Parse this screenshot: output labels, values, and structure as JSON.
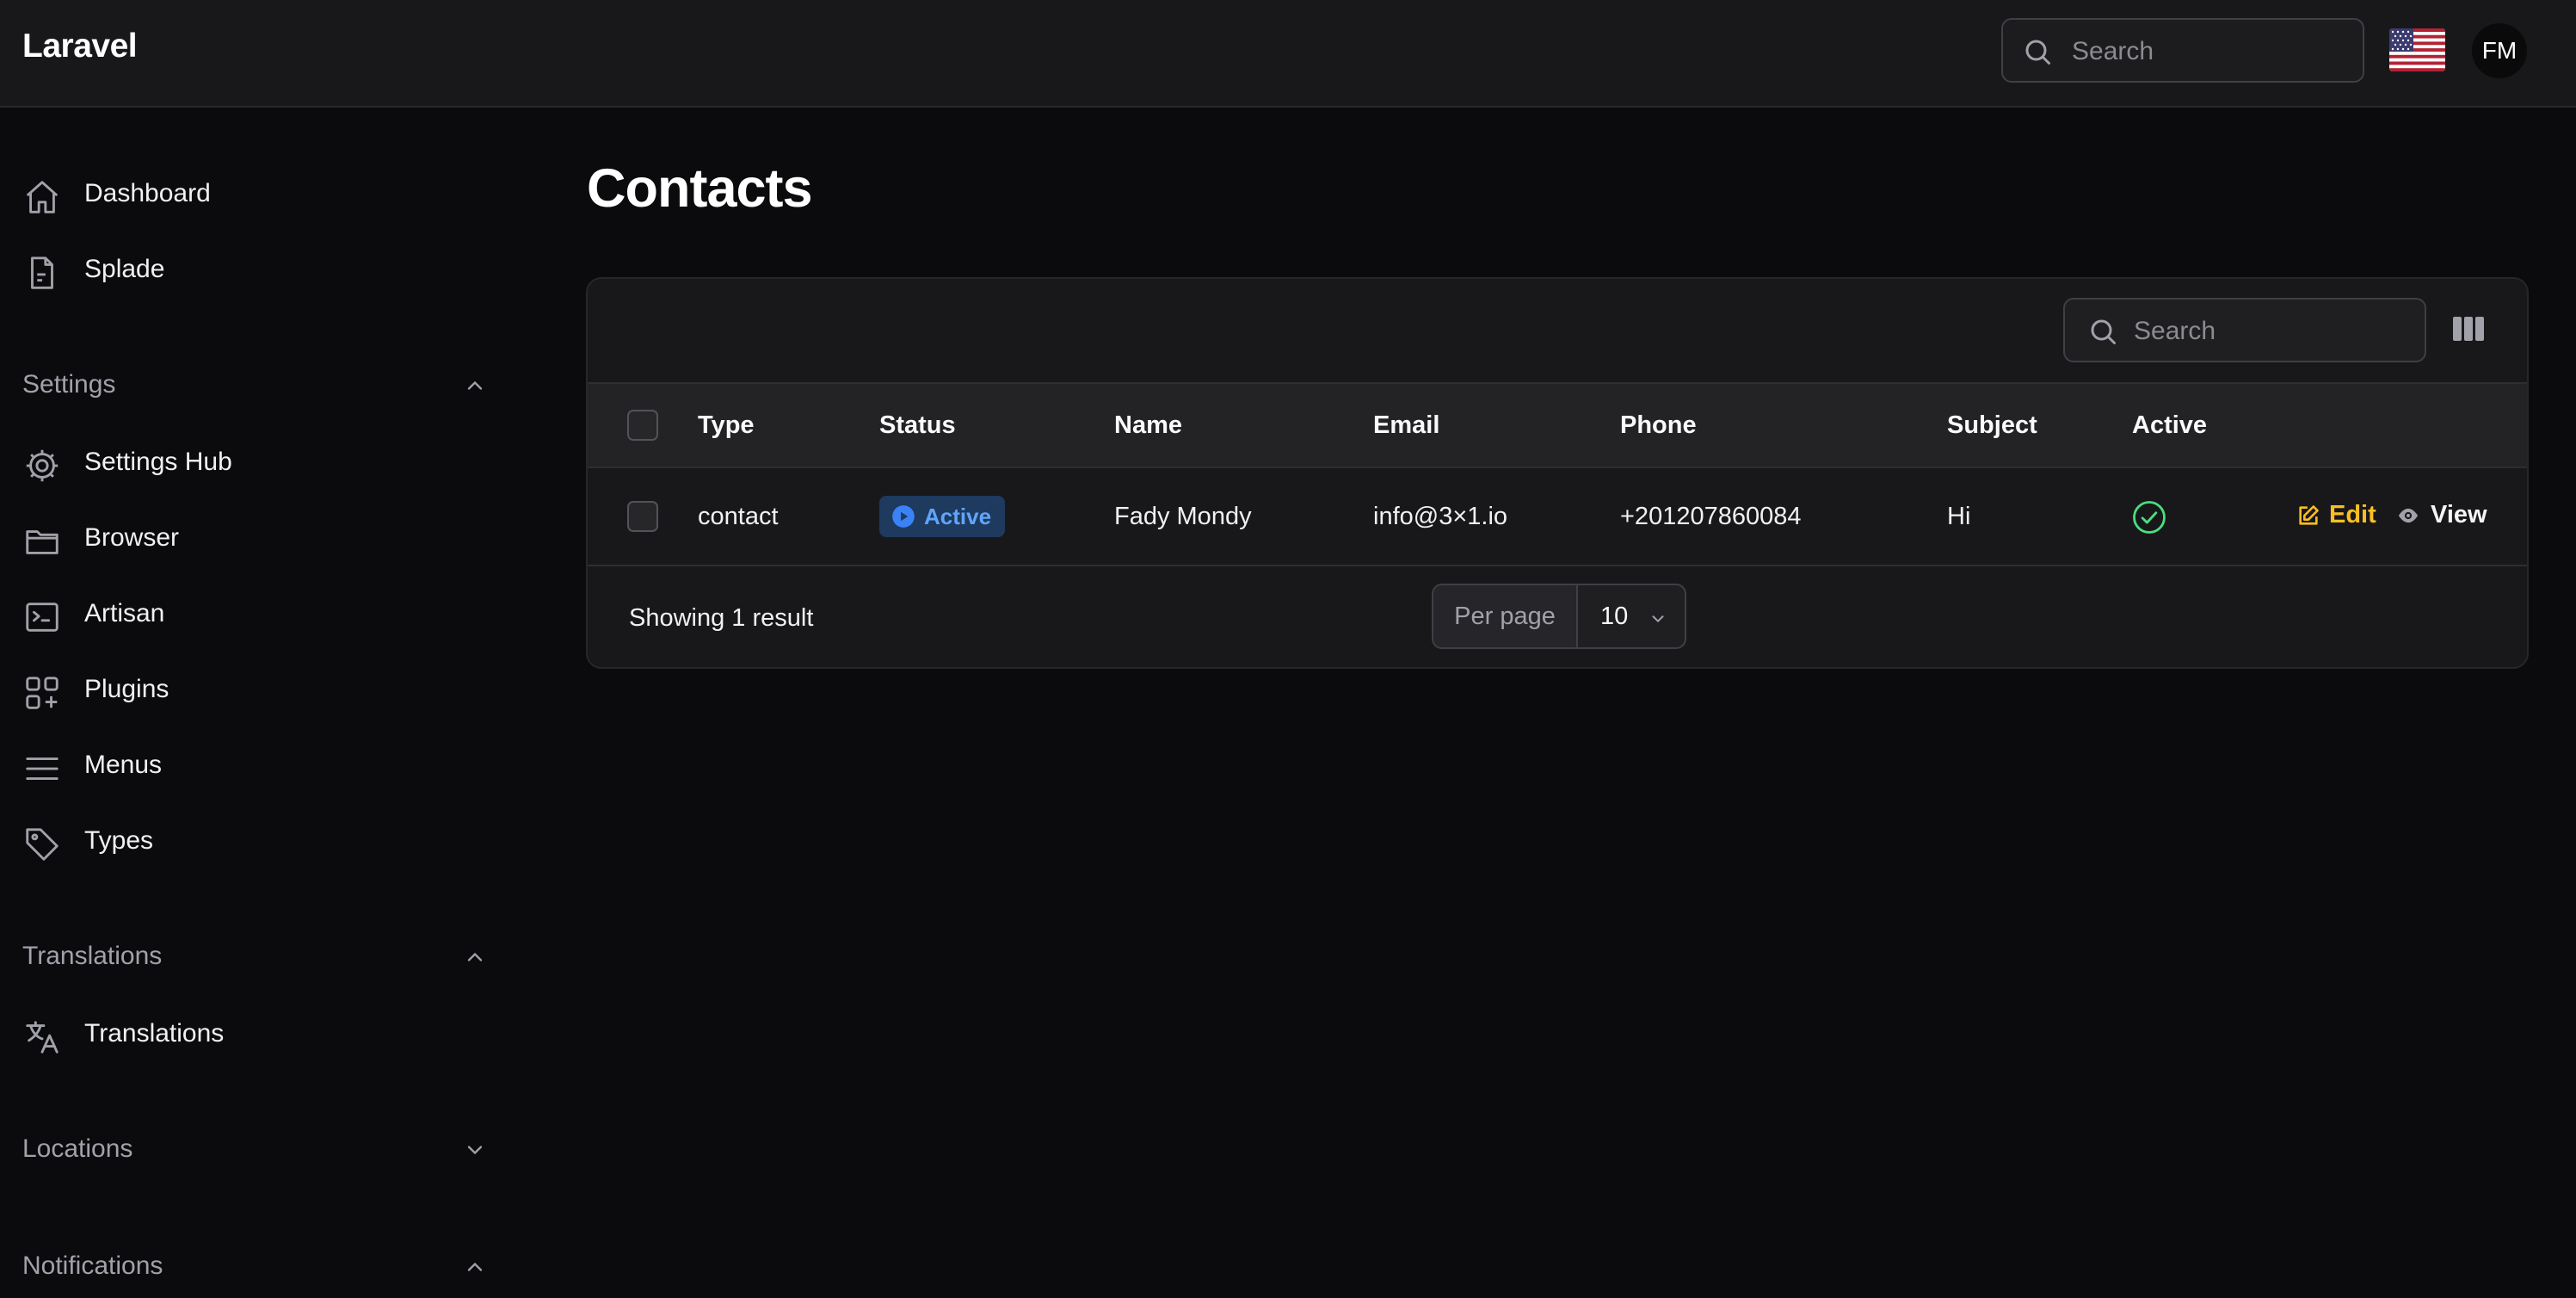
{
  "app": {
    "brand": "Laravel"
  },
  "topbar": {
    "search_placeholder": "Search",
    "user_initials": "FM",
    "flag_icon": "us-flag-icon"
  },
  "sidebar": {
    "primary": [
      {
        "label": "Dashboard",
        "icon": "home-icon"
      },
      {
        "label": "Splade",
        "icon": "document-icon"
      }
    ],
    "groups": [
      {
        "title": "Settings",
        "expanded": true,
        "items": [
          {
            "label": "Settings Hub",
            "icon": "gear-icon"
          },
          {
            "label": "Browser",
            "icon": "folder-icon"
          },
          {
            "label": "Artisan",
            "icon": "terminal-icon"
          },
          {
            "label": "Plugins",
            "icon": "plugins-icon"
          },
          {
            "label": "Menus",
            "icon": "menu-icon"
          },
          {
            "label": "Types",
            "icon": "tag-icon"
          }
        ]
      },
      {
        "title": "Translations",
        "expanded": true,
        "items": [
          {
            "label": "Translations",
            "icon": "translate-icon"
          }
        ]
      },
      {
        "title": "Locations",
        "expanded": false,
        "items": []
      },
      {
        "title": "Notifications",
        "expanded": true,
        "items": []
      }
    ]
  },
  "page": {
    "title": "Contacts"
  },
  "table": {
    "search_placeholder": "Search",
    "columns": [
      "Type",
      "Status",
      "Name",
      "Email",
      "Phone",
      "Subject",
      "Active"
    ],
    "rows": [
      {
        "type": "contact",
        "status": "Active",
        "name": "Fady Mondy",
        "email": "info@3×1.io",
        "phone": "+201207860084",
        "subject": "Hi",
        "active": true,
        "actions": {
          "edit": "Edit",
          "view": "View"
        }
      }
    ],
    "footer": {
      "summary": "Showing 1 result",
      "per_page_label": "Per page",
      "per_page_value": "10"
    }
  },
  "colors": {
    "background": "#0b0b0d",
    "surface": "#18181b",
    "status_badge_bg": "#1e3a5f",
    "status_badge_text": "#60a5fa",
    "edit_action": "#fbbf24",
    "active_check": "#4ade80"
  }
}
